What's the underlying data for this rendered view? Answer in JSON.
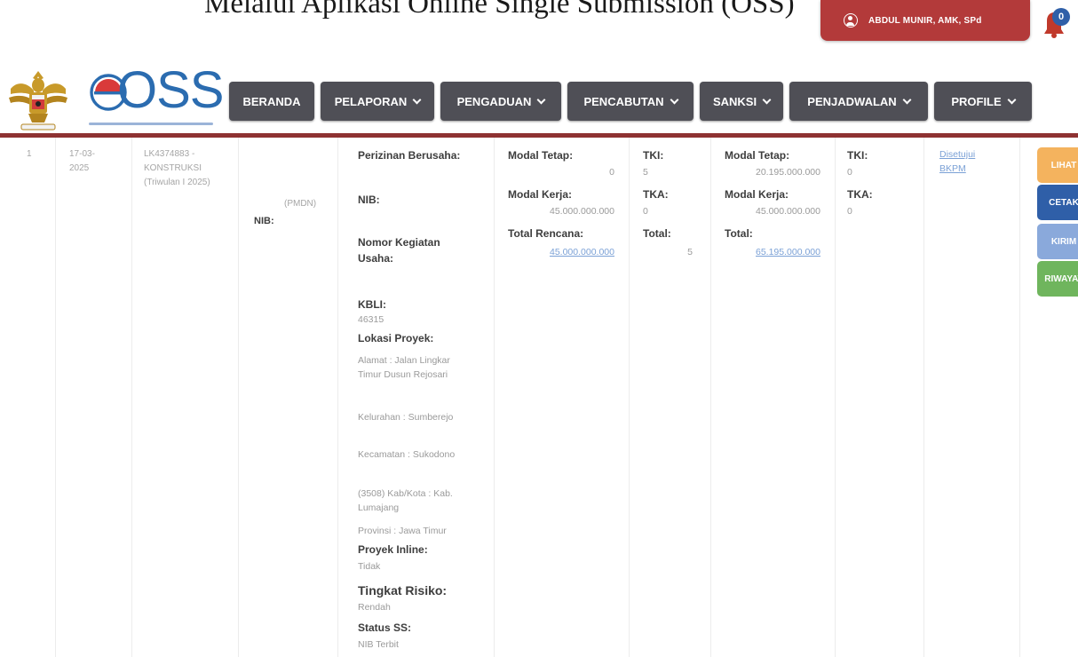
{
  "page": {
    "heading": "Melalui Aplikasi Online Single Submission (OSS)"
  },
  "header": {
    "user_name": "ABDUL MUNIR, AMK, SPd",
    "notification_count": "0",
    "logo_text": "OSS"
  },
  "nav": {
    "items": [
      {
        "label": "BERANDA",
        "dropdown": false
      },
      {
        "label": "PELAPORAN",
        "dropdown": true
      },
      {
        "label": "PENGADUAN",
        "dropdown": true
      },
      {
        "label": "PENCABUTAN",
        "dropdown": true
      },
      {
        "label": "SANKSI",
        "dropdown": true
      },
      {
        "label": "PENJADWALAN",
        "dropdown": true
      },
      {
        "label": "PROFILE",
        "dropdown": true
      }
    ]
  },
  "row": {
    "number": "1",
    "date": "17-03-2025",
    "report_code": "LK4374883 - KONSTRUKSI (Triwulan I 2025)",
    "status_pmdn": "(PMDN)",
    "nib_label": "NIB:",
    "perizinan": {
      "perizinan_label": "Perizinan Berusaha:",
      "nib_label": "NIB:",
      "nomor_kegiatan_label": "Nomor Kegiatan Usaha:",
      "kbli_label": "KBLI:",
      "kbli_value": "46315",
      "lokasi_label": "Lokasi Proyek:",
      "alamat": "Alamat : Jalan Lingkar Timur Dusun Rejosari",
      "kelurahan": "Kelurahan : Sumberejo",
      "kecamatan": "Kecamatan : Sukodono",
      "kabkota": "(3508) Kab/Kota : Kab. Lumajang",
      "provinsi": "Provinsi : Jawa Timur",
      "proyek_inline_label": "Proyek Inline:",
      "proyek_inline_value": "Tidak",
      "risiko_label": "Tingkat Risiko:",
      "risiko_value": "Rendah",
      "status_label": "Status SS:",
      "status_value": "NIB Terbit"
    },
    "rencana": {
      "modal_tetap_label": "Modal Tetap:",
      "modal_tetap_value": "0",
      "modal_kerja_label": "Modal Kerja:",
      "modal_kerja_value": "45.000.000.000",
      "total_label": "Total Rencana:",
      "total_value": "45.000.000.000",
      "tki_label": "TKI:",
      "tki_value": "5",
      "tka_label": "TKA:",
      "tka_value": "0",
      "total_tk_label": "Total:",
      "total_tk_value": "5"
    },
    "realisasi": {
      "modal_tetap_label": "Modal Tetap:",
      "modal_tetap_value": "20.195.000.000",
      "modal_kerja_label": "Modal Kerja:",
      "modal_kerja_value": "45.000.000.000",
      "total_label": "Total:",
      "total_value": "65.195.000.000",
      "tki_label": "TKI:",
      "tki_value": "0",
      "tka_label": "TKA:",
      "tka_value": "0"
    },
    "status_link": "Disetujui BKPM"
  },
  "actions": {
    "lihat": "LIHAT",
    "cetak": "CETAK",
    "kirim": "KIRIM",
    "riwayat": "RIWAYAT"
  },
  "colors": {
    "nav_bg": "#4f4f56",
    "brand_red": "#b33a3a",
    "divider_red": "#8e3232",
    "btn_orange": "#f4b35e",
    "btn_blue": "#2f5fa8",
    "btn_lightblue": "#8aa9db",
    "btn_green": "#6fb55d"
  }
}
